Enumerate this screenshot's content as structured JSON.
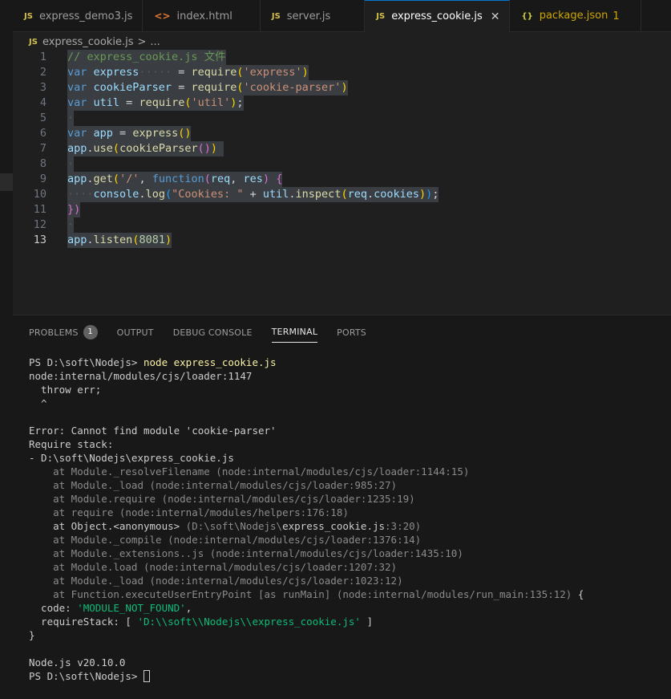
{
  "tabs": [
    {
      "icon": "JS",
      "label": "express_demo3.js"
    },
    {
      "icon": "<>",
      "label": "index.html"
    },
    {
      "icon": "JS",
      "label": "server.js"
    },
    {
      "icon": "JS",
      "label": "express_cookie.js",
      "close": "✕"
    },
    {
      "icon": "{}",
      "label": "package.json",
      "count": "1"
    }
  ],
  "breadcrumb": {
    "icon": "JS",
    "file": "express_cookie.js",
    "sep": ">",
    "more": "..."
  },
  "editor": {
    "line_numbers": [
      "1",
      "2",
      "3",
      "4",
      "5",
      "6",
      "7",
      "8",
      "9",
      "10",
      "11",
      "12",
      "13"
    ],
    "lines": {
      "l1": "// express_cookie.js 文件",
      "l2_kw": "var",
      "l2_name": "express",
      "l2_eq": " = ",
      "l2_fn": "require",
      "l2_str": "'express'",
      "l3_kw": "var",
      "l3_name": "cookieParser",
      "l3_eq": " = ",
      "l3_fn": "require",
      "l3_str": "'cookie-parser'",
      "l4_kw": "var",
      "l4_name": "util",
      "l4_eq": " = ",
      "l4_fn": "require",
      "l4_str": "'util'",
      "l4_end": ";",
      "l6_kw": "var",
      "l6_name": "app",
      "l6_eq": " = ",
      "l6_fn": "express",
      "l7_obj": "app",
      "l7_fn": "use",
      "l7_arg": "cookieParser",
      "l9_obj": "app",
      "l9_fn": "get",
      "l9_str": "'/'",
      "l9_kw": "function",
      "l9_p1": "req",
      "l9_p2": "res",
      "l10_obj": "console",
      "l10_fn": "log",
      "l10_str": "\"Cookies: \"",
      "l10_plus": " + ",
      "l10_u": "util",
      "l10_fn2": "inspect",
      "l10_arg": "req",
      "l10_prop": "cookies",
      "l10_end": ";",
      "l11": "})",
      "l13_obj": "app",
      "l13_fn": "listen",
      "l13_num": "8081"
    }
  },
  "panel": {
    "tabs": {
      "problems": "PROBLEMS",
      "problems_count": "1",
      "output": "OUTPUT",
      "debug": "DEBUG CONSOLE",
      "terminal": "TERMINAL",
      "ports": "PORTS"
    },
    "terminal": {
      "prompt1": "PS D:\\soft\\Nodejs> ",
      "cmd": "node express_cookie.js",
      "lines": [
        "node:internal/modules/cjs/loader:1147",
        "  throw err;",
        "  ^",
        "",
        "Error: Cannot find module 'cookie-parser'",
        "Require stack:",
        "- D:\\soft\\Nodejs\\express_cookie.js"
      ],
      "stack": [
        {
          "fn": "    at Module._resolveFilename ",
          "loc": "(node:internal/modules/cjs/loader:1144:15)"
        },
        {
          "fn": "    at Module._load ",
          "loc": "(node:internal/modules/cjs/loader:985:27)"
        },
        {
          "fn": "    at Module.require ",
          "loc": "(node:internal/modules/cjs/loader:1235:19)"
        },
        {
          "fn": "    at require ",
          "loc": "(node:internal/modules/helpers:176:18)"
        }
      ],
      "anon_fn": "    at Object.<anonymous> ",
      "anon_loc_a": "(D:\\soft\\Nodejs\\",
      "anon_loc_b": "express_cookie.js",
      "anon_loc_c": ":3:20)",
      "stack2": [
        {
          "fn": "    at Module._compile ",
          "loc": "(node:internal/modules/cjs/loader:1376:14)"
        },
        {
          "fn": "    at Module._extensions..js ",
          "loc": "(node:internal/modules/cjs/loader:1435:10)"
        },
        {
          "fn": "    at Module.load ",
          "loc": "(node:internal/modules/cjs/loader:1207:32)"
        },
        {
          "fn": "    at Module._load ",
          "loc": "(node:internal/modules/cjs/loader:1023:12)"
        },
        {
          "fn": "    at Function.executeUserEntryPoint [as runMain] ",
          "loc": "(node:internal/modules/run_main:135:12)"
        }
      ],
      "brace_open": " {",
      "code_key": "  code: ",
      "code_val": "'MODULE_NOT_FOUND'",
      "code_end": ",",
      "req_key": "  requireStack: [ ",
      "req_val": "'D:\\\\soft\\\\Nodejs\\\\express_cookie.js'",
      "req_end": " ]",
      "brace_close": "}",
      "node_version": "Node.js v20.10.0",
      "prompt2": "PS D:\\soft\\Nodejs> "
    }
  }
}
